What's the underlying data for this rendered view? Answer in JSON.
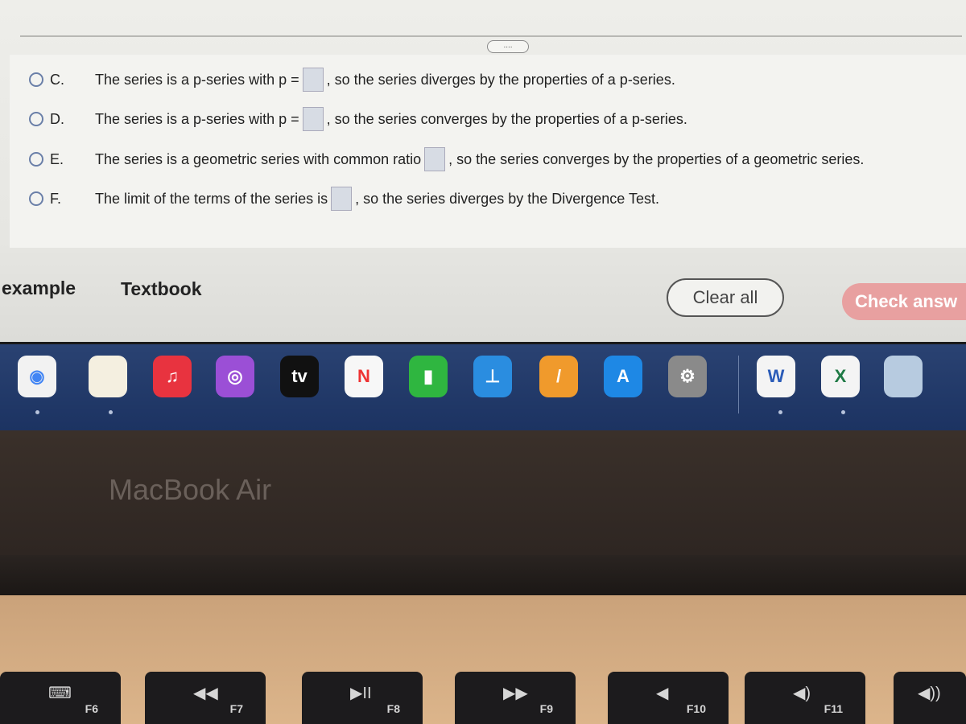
{
  "question": {
    "more_label": "....",
    "options": [
      {
        "letter": "C.",
        "pre": "The series is a p-series with p =",
        "post": ", so the series diverges by the properties of a p-series."
      },
      {
        "letter": "D.",
        "pre": "The series is a p-series with p =",
        "post": ", so the series converges by the properties of a p-series."
      },
      {
        "letter": "E.",
        "pre": "The series is a geometric series with common ratio",
        "post": ", so the series converges by the properties of a geometric series."
      },
      {
        "letter": "F.",
        "pre": "The limit of the terms of the series is",
        "post": ", so the series diverges by the Divergence Test."
      }
    ]
  },
  "footer": {
    "example": "example",
    "textbook": "Textbook",
    "clear_all": "Clear all",
    "check_answer": "Check answ"
  },
  "dock": {
    "apps": [
      {
        "name": "chrome",
        "color": "#f2f2f2",
        "glyph": "◉"
      },
      {
        "name": "notes",
        "color": "#f4efe0",
        "glyph": ""
      },
      {
        "name": "music",
        "color": "#e8333f",
        "glyph": "♫"
      },
      {
        "name": "podcasts",
        "color": "#9b4fd6",
        "glyph": "◎"
      },
      {
        "name": "tv",
        "color": "#111111",
        "glyph": "tv"
      },
      {
        "name": "news",
        "color": "#f7f7f7",
        "glyph": "N"
      },
      {
        "name": "numbers",
        "color": "#2fb640",
        "glyph": "▮"
      },
      {
        "name": "keynote",
        "color": "#2a8de0",
        "glyph": "⊥"
      },
      {
        "name": "pages",
        "color": "#f09a2c",
        "glyph": "/"
      },
      {
        "name": "app-store",
        "color": "#1e88e5",
        "glyph": "A"
      },
      {
        "name": "system-preferences",
        "color": "#8a8a8a",
        "glyph": "⚙"
      },
      {
        "name": "word",
        "color": "#f4f4f4",
        "glyph": "W"
      },
      {
        "name": "excel",
        "color": "#f4f4f4",
        "glyph": "X"
      },
      {
        "name": "preview",
        "color": "#b7cbe0",
        "glyph": ""
      }
    ]
  },
  "laptop": {
    "brand": "MacBook Air"
  },
  "keys": [
    {
      "label": "F6",
      "symbol": "⌨"
    },
    {
      "label": "F7",
      "symbol": "◀◀"
    },
    {
      "label": "F8",
      "symbol": "▶II"
    },
    {
      "label": "F9",
      "symbol": "▶▶"
    },
    {
      "label": "F10",
      "symbol": "◀"
    },
    {
      "label": "F11",
      "symbol": "◀)"
    },
    {
      "label": "",
      "symbol": "◀))"
    }
  ]
}
